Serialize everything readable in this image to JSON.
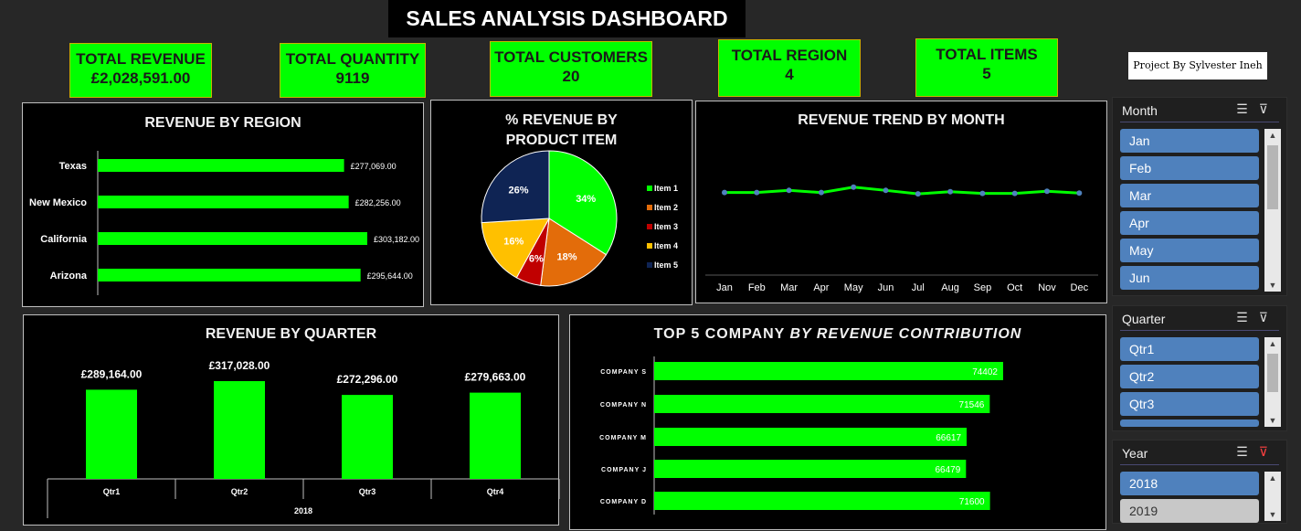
{
  "title": "SALES ANALYSIS DASHBOARD",
  "credit": "Project By Sylvester Ineh",
  "kpis": [
    {
      "label": "TOTAL REVENUE",
      "value": "£2,028,591.00"
    },
    {
      "label": "TOTAL QUANTITY",
      "value": "9119"
    },
    {
      "label": "TOTAL CUSTOMERS",
      "value": "20"
    },
    {
      "label": "TOTAL REGION",
      "value": "4"
    },
    {
      "label": "TOTAL ITEMS",
      "value": "5"
    }
  ],
  "colors": {
    "accent": "#00ff00",
    "panel": "#000000",
    "background": "#272727",
    "slicer_item": "#4f81bd"
  },
  "slicers": {
    "month": {
      "label": "Month",
      "items": [
        "Jan",
        "Feb",
        "Mar",
        "Apr",
        "May",
        "Jun"
      ]
    },
    "quarter": {
      "label": "Quarter",
      "items": [
        "Qtr1",
        "Qtr2",
        "Qtr3"
      ]
    },
    "year": {
      "label": "Year",
      "items": [
        "2018",
        "2019"
      ]
    }
  },
  "chart_data": [
    {
      "type": "bar",
      "orientation": "horizontal",
      "title": "REVENUE BY REGION",
      "categories": [
        "Texas",
        "New Mexico",
        "California",
        "Arizona"
      ],
      "values": [
        277069,
        282256,
        303182,
        295644
      ],
      "labels": [
        "£277,069.00",
        "£282,256.00",
        "£303,182.00",
        "£295,644.00"
      ],
      "color": "#00ff00"
    },
    {
      "type": "pie",
      "title": "% REVENUE BY PRODUCT ITEM",
      "categories": [
        "Item 1",
        "Item 2",
        "Item 3",
        "Item 4",
        "Item 5"
      ],
      "values": [
        34,
        18,
        6,
        16,
        26
      ],
      "labels": [
        "34%",
        "18%",
        "6%",
        "16%",
        "26%"
      ],
      "colors": [
        "#00ff00",
        "#e36c0a",
        "#c00000",
        "#ffc000",
        "#0f2454"
      ],
      "legend": "right"
    },
    {
      "type": "line",
      "title": "REVENUE TREND BY MONTH",
      "categories": [
        "Jan",
        "Feb",
        "Mar",
        "Apr",
        "May",
        "Jun",
        "Jul",
        "Aug",
        "Sep",
        "Oct",
        "Nov",
        "Dec"
      ],
      "values": [
        170000,
        170000,
        178000,
        170000,
        190000,
        178000,
        165000,
        173000,
        167000,
        167000,
        175000,
        168000
      ],
      "color": "#00ff00",
      "ylim": [
        0,
        500000
      ]
    },
    {
      "type": "bar",
      "title": "REVENUE BY QUARTER",
      "categories": [
        "Qtr1",
        "Qtr2",
        "Qtr3",
        "Qtr4"
      ],
      "group_label": "2018",
      "values": [
        289164,
        317028,
        272296,
        279663
      ],
      "labels": [
        "£289,164.00",
        "£317,028.00",
        "£272,296.00",
        "£279,663.00"
      ],
      "color": "#00ff00"
    },
    {
      "type": "bar",
      "orientation": "horizontal",
      "title": "TOP 5 COMPANY BY REVENUE CONTRIBUTION",
      "title_plain": "TOP 5 COMPANY",
      "title_italic": "BY REVENUE CONTRIBUTION",
      "categories": [
        "COMPANY S",
        "COMPANY N",
        "COMPANY M",
        "COMPANY J",
        "COMPANY D"
      ],
      "values": [
        74402,
        71546,
        66617,
        66479,
        71600
      ],
      "labels": [
        "74402",
        "71546",
        "66617",
        "66479",
        "71600"
      ],
      "color": "#00ff00"
    }
  ]
}
